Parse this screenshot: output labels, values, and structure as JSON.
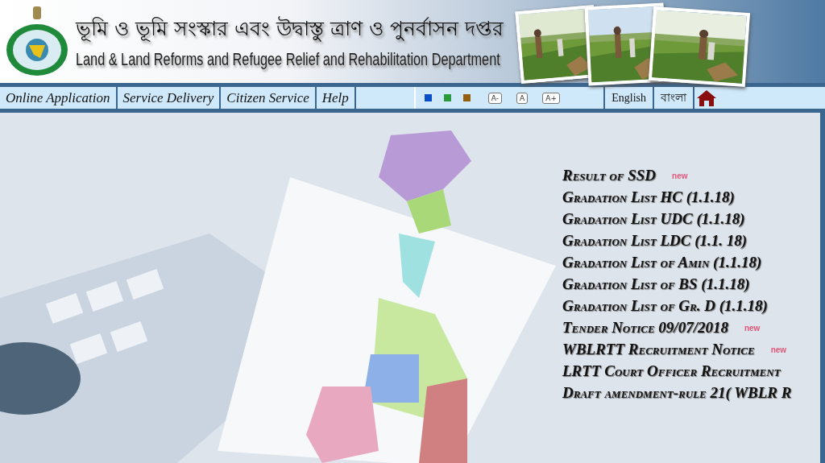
{
  "header": {
    "title_bengali": "ভূমি ও ভূমি সংস্কার এবং উদ্বাস্তু ত্রাণ ও পুনর্বাসন দপ্তর",
    "title_english": "Land & Land Reforms and Refugee Relief and Rehabilitation Department"
  },
  "nav": {
    "menu": [
      "Online Application",
      "Service Delivery",
      "Citizen Service",
      "Help"
    ],
    "themes": [
      {
        "color": "#0b4fc8"
      },
      {
        "color": "#2a9a3a"
      },
      {
        "color": "#946010"
      }
    ],
    "font_sizes": [
      "A-",
      "A",
      "A+"
    ],
    "languages": [
      "English",
      "বাংলা"
    ]
  },
  "notices": [
    {
      "title": "Result of SSD",
      "badge": "new"
    },
    {
      "title": "Gradation List HC (1.1.18)"
    },
    {
      "title": "Gradation List UDC (1.1.18)"
    },
    {
      "title": "Gradation List LDC (1.1. 18)"
    },
    {
      "title": "Gradation List of Amin (1.1.18)"
    },
    {
      "title": "Gradation List of BS (1.1.18)"
    },
    {
      "title": "Gradation List of Gr. D (1.1.18)"
    },
    {
      "title": "Tender Notice 09/07/2018",
      "badge": "new"
    },
    {
      "title": "WBLRTT Recruitment Notice",
      "badge": "new"
    },
    {
      "title": "LRTT Court Officer Recruitment"
    },
    {
      "title": "Draft amendment-rule 21( WBLR R"
    }
  ]
}
